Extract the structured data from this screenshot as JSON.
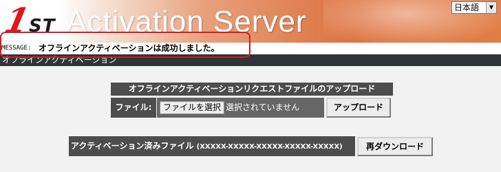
{
  "header": {
    "logo_number": "1",
    "logo_suffix": "ST",
    "title": "Activation Server",
    "language": "日本語"
  },
  "message": {
    "prefix": "MESSAGE:",
    "text": "オフラインアクティベーションは成功しました。"
  },
  "breadcrumb": {
    "text": "オフラインアクティベーション"
  },
  "upload": {
    "title": "オフラインアクティベーションリクエストファイルのアップロード",
    "file_label": "ファイル:",
    "choose_button": "ファイルを選択",
    "no_file_text": "選択されていません",
    "upload_button": "アップロード"
  },
  "activated": {
    "label": "アクティベーション済みファイル",
    "serial": "(XXXXX-XXXXX-XXXXX-XXXXX-XXXXX)",
    "redownload_button": "再ダウンロード"
  },
  "colors": {
    "accent_red": "#d41c24",
    "header_orange": "#dc6f3c",
    "dark_bar": "#2f3437",
    "panel_gray": "#4d4d4d"
  }
}
